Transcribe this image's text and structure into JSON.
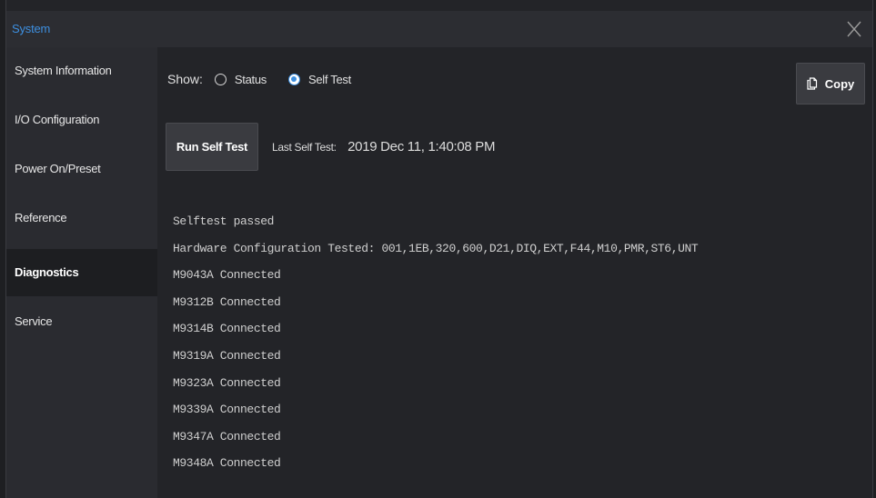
{
  "window": {
    "title": "System"
  },
  "sidebar": {
    "items": [
      {
        "label": "System Information",
        "active": false
      },
      {
        "label": "I/O Configuration",
        "active": false
      },
      {
        "label": "Power On/Preset",
        "active": false
      },
      {
        "label": "Reference",
        "active": false
      },
      {
        "label": "Diagnostics",
        "active": true
      },
      {
        "label": "Service",
        "active": false
      }
    ]
  },
  "main": {
    "show_label": "Show:",
    "radios": [
      {
        "label": "Status",
        "checked": false
      },
      {
        "label": "Self Test",
        "checked": true
      }
    ],
    "copy_label": "Copy",
    "run_self_test_label": "Run Self Test",
    "last_self_test_label": "Last Self Test:",
    "last_self_test_value": "2019 Dec 11, 1:40:08 PM",
    "log_lines": [
      "Selftest passed",
      "Hardware Configuration Tested: 001,1EB,320,600,D21,DIQ,EXT,F44,M10,PMR,ST6,UNT",
      "M9043A Connected",
      "M9312B Connected",
      "M9314B Connected",
      "M9319A Connected",
      "M9323A Connected",
      "M9339A Connected",
      "M9347A Connected",
      "M9348A Connected"
    ]
  },
  "icons": {
    "close": "close-icon",
    "copy": "clipboard-icon"
  },
  "colors": {
    "accent": "#3d8fe0",
    "background": "#232428",
    "sidebar": "#2a2b30",
    "active_item": "#1d1e21"
  }
}
